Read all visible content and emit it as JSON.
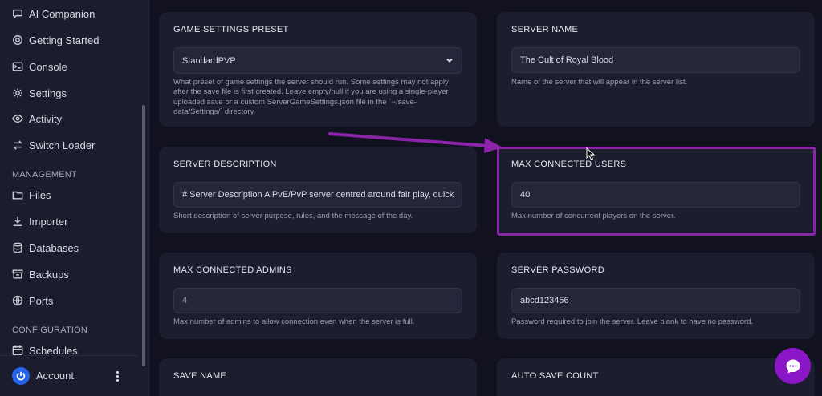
{
  "sidebar": {
    "items": [
      {
        "label": "AI Companion",
        "icon": "chat-icon"
      },
      {
        "label": "Getting Started",
        "icon": "gear-icon"
      },
      {
        "label": "Console",
        "icon": "terminal-icon"
      },
      {
        "label": "Settings",
        "icon": "gear-icon"
      },
      {
        "label": "Activity",
        "icon": "eye-icon"
      },
      {
        "label": "Switch Loader",
        "icon": "switch-icon"
      }
    ],
    "management_label": "MANAGEMENT",
    "management_items": [
      {
        "label": "Files",
        "icon": "folder-icon"
      },
      {
        "label": "Importer",
        "icon": "download-icon"
      },
      {
        "label": "Databases",
        "icon": "database-icon"
      },
      {
        "label": "Backups",
        "icon": "archive-icon"
      },
      {
        "label": "Ports",
        "icon": "globe-icon"
      }
    ],
    "configuration_label": "CONFIGURATION",
    "configuration_items": [
      {
        "label": "Schedules",
        "icon": "calendar-icon"
      }
    ],
    "account_label": "Account"
  },
  "settings": {
    "game_settings_preset": {
      "label": "GAME SETTINGS PRESET",
      "value": "StandardPVP",
      "help": "What preset of game settings the server should run. Some settings may not apply after the save file is first created. Leave empty/null if you are using a single-player uploaded save or a custom ServerGameSettings.json file in the `~/save-data/Settings/` directory."
    },
    "server_name": {
      "label": "SERVER NAME",
      "value": "The Cult of Royal Blood",
      "help": "Name of the server that will appear in the server list."
    },
    "server_description": {
      "label": "SERVER DESCRIPTION",
      "value": "# Server Description A PvE/PvP server centred around fair play, quick",
      "help": "Short description of server purpose, rules, and the message of the day."
    },
    "max_connected_users": {
      "label": "MAX CONNECTED USERS",
      "value": "40",
      "help": "Max number of concurrent players on the server."
    },
    "max_connected_admins": {
      "label": "MAX CONNECTED ADMINS",
      "value": "4",
      "help": "Max number of admins to allow connection even when the server is full."
    },
    "server_password": {
      "label": "SERVER PASSWORD",
      "value": "abcd123456",
      "help": "Password required to join the server. Leave blank to have no password."
    },
    "save_name": {
      "label": "SAVE NAME"
    },
    "auto_save_count": {
      "label": "AUTO SAVE COUNT"
    }
  },
  "colors": {
    "accent_purple": "#8b24a8",
    "chat_bubble": "#8b16c7",
    "account_avatar": "#2563eb"
  }
}
